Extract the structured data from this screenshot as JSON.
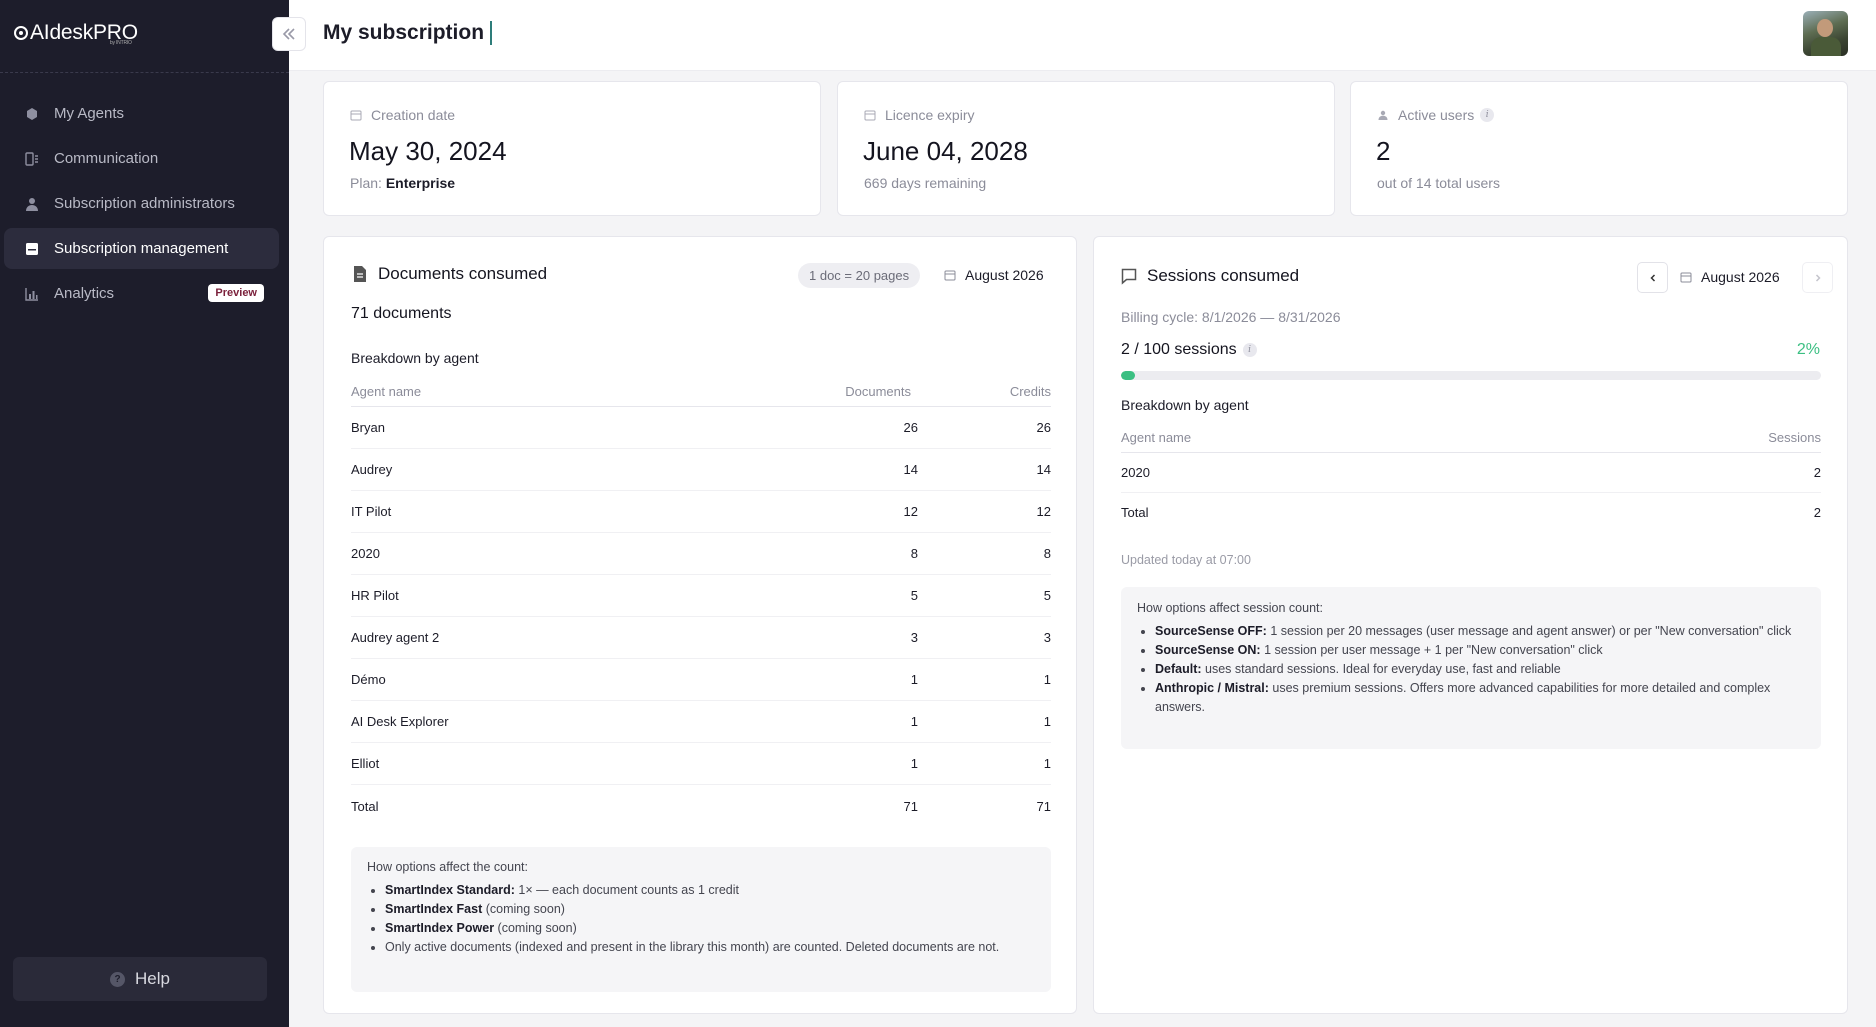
{
  "app": {
    "logo": "AIdeskPRO",
    "logo_sub": "by INTRIO"
  },
  "sidebar": {
    "items": [
      {
        "label": "My Agents",
        "icon": "agents-icon"
      },
      {
        "label": "Communication",
        "icon": "communication-icon"
      },
      {
        "label": "Subscription administrators",
        "icon": "user-icon"
      },
      {
        "label": "Subscription management",
        "icon": "subscription-icon",
        "active": true
      },
      {
        "label": "Analytics",
        "icon": "chart-icon",
        "badge": "Preview"
      }
    ],
    "help_label": "Help"
  },
  "header": {
    "title": "My subscription"
  },
  "stats": {
    "creation": {
      "label": "Creation date",
      "value": "May 30, 2024",
      "plan_prefix": "Plan:",
      "plan_value": "Enterprise"
    },
    "expiry": {
      "label": "Licence expiry",
      "value": "June 04, 2028",
      "sub": "669 days remaining"
    },
    "users": {
      "label": "Active users",
      "value": "2",
      "sub": "out of 14 total users"
    }
  },
  "documents": {
    "title": "Documents consumed",
    "chip": "1 doc = 20 pages",
    "month": "August 2026",
    "count": "71 documents",
    "breakdown_title": "Breakdown by agent",
    "columns": [
      "Agent name",
      "Documents",
      "Credits"
    ],
    "rows": [
      [
        "Bryan",
        "26",
        "26"
      ],
      [
        "Audrey",
        "14",
        "14"
      ],
      [
        "IT Pilot",
        "12",
        "12"
      ],
      [
        "2020",
        "8",
        "8"
      ],
      [
        "HR Pilot",
        "5",
        "5"
      ],
      [
        "Audrey agent 2",
        "3",
        "3"
      ],
      [
        "Démo",
        "1",
        "1"
      ],
      [
        "AI Desk Explorer",
        "1",
        "1"
      ],
      [
        "Elliot",
        "1",
        "1"
      ]
    ],
    "total": [
      "Total",
      "71",
      "71"
    ],
    "note": {
      "heading": "How options affect the count:",
      "items": [
        {
          "bold": "SmartIndex Standard:",
          "text": " 1× — each document counts as 1 credit"
        },
        {
          "bold": "SmartIndex Fast",
          "text": " (coming soon)"
        },
        {
          "bold": "SmartIndex Power",
          "text": " (coming soon)"
        },
        {
          "bold": "",
          "text": "Only active documents (indexed and present in the library this month) are counted. Deleted documents are not."
        }
      ]
    }
  },
  "sessions": {
    "title": "Sessions consumed",
    "month": "August 2026",
    "billing_cycle": "Billing cycle: 8/1/2026 — 8/31/2026",
    "count": "2 / 100 sessions",
    "percent": "2%",
    "progress_fraction": 0.02,
    "breakdown_title": "Breakdown by agent",
    "columns": [
      "Agent name",
      "Sessions"
    ],
    "rows": [
      [
        "2020",
        "2"
      ]
    ],
    "total": [
      "Total",
      "2"
    ],
    "updated": "Updated today at 07:00",
    "note": {
      "heading": "How options affect session count:",
      "items": [
        {
          "bold": "SourceSense OFF:",
          "text": " 1 session per 20 messages (user message and agent answer) or per \"New conversation\" click"
        },
        {
          "bold": "SourceSense ON:",
          "text": " 1 session per user message + 1 per \"New conversation\" click"
        },
        {
          "bold": "Default:",
          "text": " uses standard sessions. Ideal for everyday use, fast and reliable"
        },
        {
          "bold": "Anthropic / Mistral:",
          "text": " uses premium sessions. Offers more advanced capabilities for more detailed and complex answers."
        }
      ]
    }
  }
}
